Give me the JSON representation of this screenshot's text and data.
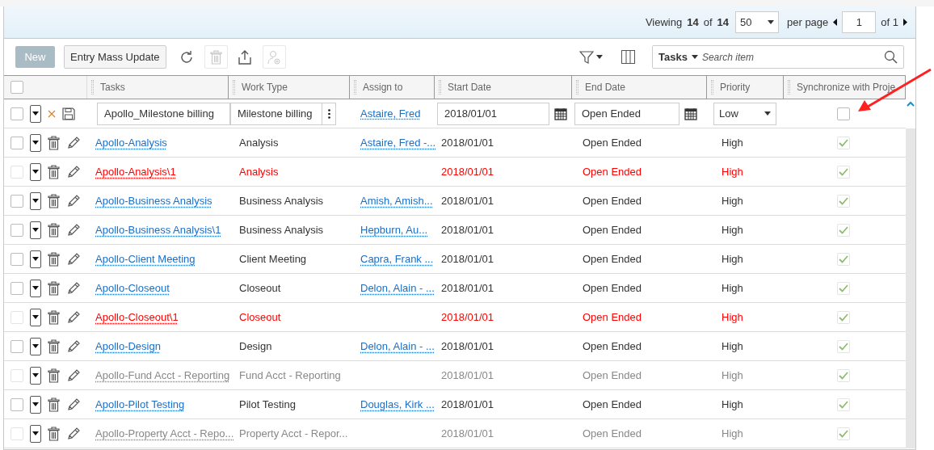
{
  "pager": {
    "viewing_label": "Viewing",
    "shown": "14",
    "of_label": "of",
    "total": "14",
    "per_page": "50",
    "per_page_label": "per page",
    "page": "1",
    "of_pages": "of 1"
  },
  "toolbar": {
    "new_button": "New",
    "mass_update_button": "Entry Mass Update",
    "icon_buttons": [
      {
        "kind": "refresh",
        "disabled": false
      },
      {
        "kind": "delete",
        "disabled": true
      },
      {
        "kind": "export",
        "disabled": false
      },
      {
        "kind": "assign",
        "disabled": true
      }
    ],
    "search": {
      "scope": "Tasks",
      "placeholder": "Search item"
    }
  },
  "select_all_checked": false,
  "columns": [
    "Tasks",
    "Work Type",
    "Assign to",
    "Start Date",
    "End Date",
    "Priority",
    "Synchronize with Proje"
  ],
  "edit_row": {
    "selected": false,
    "task": "Apollo_Milestone billing",
    "work_type": "Milestone billing",
    "assign_to": "Astaire, Fred",
    "start_date": "2018/01/01",
    "end_date": "Open Ended",
    "priority": "Low",
    "synchronize": false
  },
  "rows": [
    {
      "kind": "normal",
      "selected": false,
      "task": "Apollo-Analysis",
      "work_type": "Analysis",
      "assign_to": "Astaire, Fred -...",
      "start_date": "2018/01/01",
      "end_date": "Open Ended",
      "priority": "High",
      "synchronize": true
    },
    {
      "kind": "error",
      "selected": false,
      "task": "Apollo-Analysis\\1",
      "work_type": "Analysis",
      "start_date": "2018/01/01",
      "end_date": "Open Ended",
      "priority": "High",
      "synchronize": true
    },
    {
      "kind": "normal",
      "selected": false,
      "task": "Apollo-Business Analysis",
      "work_type": "Business Analysis",
      "assign_to": "Amish, Amish...",
      "start_date": "2018/01/01",
      "end_date": "Open Ended",
      "priority": "High",
      "synchronize": true
    },
    {
      "kind": "normal",
      "selected": false,
      "task": "Apollo-Business Analysis\\1",
      "work_type": "Business Analysis",
      "assign_to": "Hepburn, Au...",
      "start_date": "2018/01/01",
      "end_date": "Open Ended",
      "priority": "High",
      "synchronize": true
    },
    {
      "kind": "normal",
      "selected": false,
      "task": "Apollo-Client Meeting",
      "work_type": "Client Meeting",
      "assign_to": "Capra, Frank ...",
      "start_date": "2018/01/01",
      "end_date": "Open Ended",
      "priority": "High",
      "synchronize": true
    },
    {
      "kind": "normal",
      "selected": false,
      "task": "Apollo-Closeout",
      "work_type": "Closeout",
      "assign_to": "Delon, Alain - ...",
      "start_date": "2018/01/01",
      "end_date": "Open Ended",
      "priority": "High",
      "synchronize": true
    },
    {
      "kind": "error",
      "selected": false,
      "task": "Apollo-Closeout\\1",
      "work_type": "Closeout",
      "start_date": "2018/01/01",
      "end_date": "Open Ended",
      "priority": "High",
      "synchronize": true
    },
    {
      "kind": "normal",
      "selected": false,
      "task": "Apollo-Design",
      "work_type": "Design",
      "assign_to": "Delon, Alain - ...",
      "start_date": "2018/01/01",
      "end_date": "Open Ended",
      "priority": "High",
      "synchronize": true
    },
    {
      "kind": "inactive",
      "selected": false,
      "task": "Apollo-Fund Acct - Reporting",
      "work_type": "Fund Acct - Reporting",
      "start_date": "2018/01/01",
      "end_date": "Open Ended",
      "priority": "High",
      "synchronize": true
    },
    {
      "kind": "normal",
      "selected": false,
      "task": "Apollo-Pilot Testing",
      "work_type": "Pilot Testing",
      "assign_to": "Douglas, Kirk ...",
      "start_date": "2018/01/01",
      "end_date": "Open Ended",
      "priority": "High",
      "synchronize": true
    },
    {
      "kind": "inactive",
      "selected": false,
      "task": "Apollo-Property Acct - Repo...",
      "work_type": "Property Acct - Repor...",
      "start_date": "2018/01/01",
      "end_date": "Open Ended",
      "priority": "High",
      "synchronize": true
    }
  ]
}
